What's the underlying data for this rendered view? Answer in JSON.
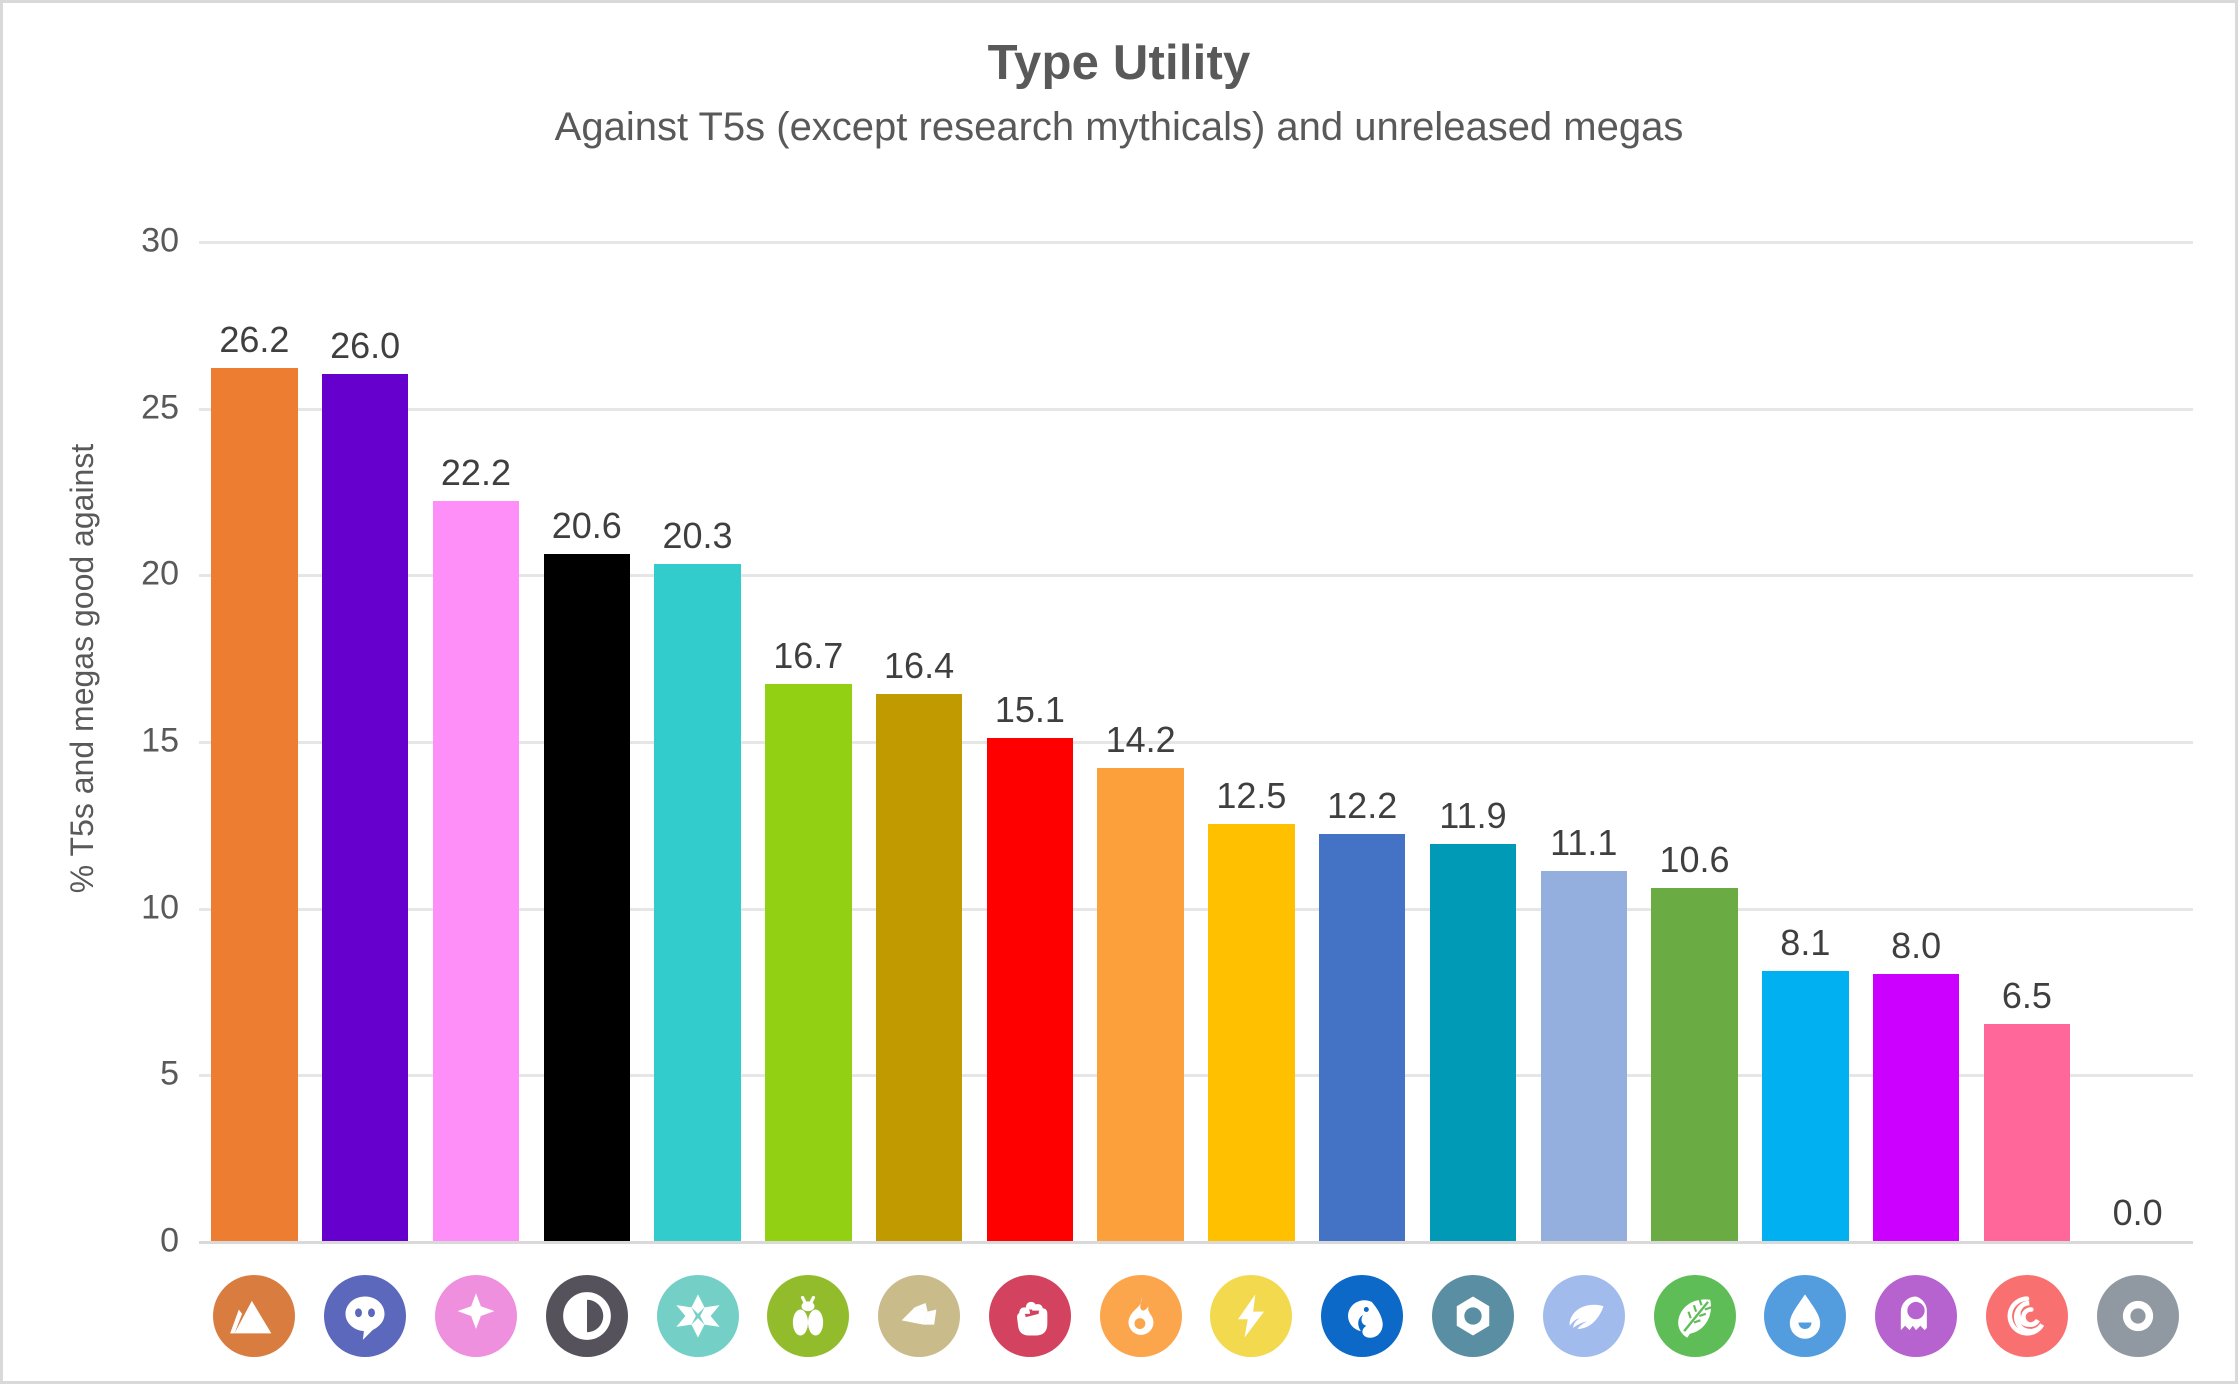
{
  "chart_data": {
    "type": "bar",
    "title": "Type Utility",
    "subtitle": "Against T5s (except research mythicals) and unreleased megas",
    "xlabel": "",
    "ylabel": "% T5s and megas good against",
    "ylim": [
      0,
      30
    ],
    "yticks": [
      "30",
      "25",
      "20",
      "15",
      "10",
      "5",
      "0"
    ],
    "ytick_values": [
      30,
      25,
      20,
      15,
      10,
      5,
      0
    ],
    "grid": true,
    "legend": "none",
    "categories": [
      "Ground",
      "Psychic",
      "Fairy",
      "Dark",
      "Ice",
      "Bug",
      "Rock",
      "Fighting",
      "Fire",
      "Electric",
      "Dragon",
      "Steel",
      "Flying",
      "Grass",
      "Water",
      "Ghost",
      "Poison",
      "Normal"
    ],
    "values": [
      26.2,
      26.0,
      22.2,
      20.6,
      20.3,
      16.7,
      16.4,
      15.1,
      14.2,
      12.5,
      12.2,
      11.9,
      11.1,
      10.6,
      8.1,
      8.0,
      6.5,
      0.0
    ],
    "data_labels": [
      "26.2",
      "26.0",
      "22.2",
      "20.6",
      "20.3",
      "16.7",
      "16.4",
      "15.1",
      "14.2",
      "12.5",
      "12.2",
      "11.9",
      "11.1",
      "10.6",
      "8.1",
      "8.0",
      "6.5",
      "0.0"
    ],
    "bar_colors": [
      "#ED7D31",
      "#6600CC",
      "#FF8FF8",
      "#000000",
      "#33CCCC",
      "#92D014",
      "#C19A00",
      "#FF0000",
      "#FCA03C",
      "#FFC000",
      "#4472C4",
      "#0099B6",
      "#94AFDD",
      "#6AAB44",
      "#00B0F0",
      "#CC00FF",
      "#FF6699",
      "#A6A6A6"
    ],
    "icons": [
      {
        "name": "ground-type-icon",
        "label": "Ground",
        "bg": "#D97C3F",
        "glyph": "mountain"
      },
      {
        "name": "psychic-type-icon",
        "label": "Psychic",
        "bg": "#5B68BB",
        "glyph": "psychic-face"
      },
      {
        "name": "fairy-type-icon",
        "label": "Fairy",
        "bg": "#EE90DE",
        "glyph": "sparkle"
      },
      {
        "name": "dark-type-icon",
        "label": "Dark",
        "bg": "#55525C",
        "glyph": "moon"
      },
      {
        "name": "ice-type-icon",
        "label": "Ice",
        "bg": "#74CFC6",
        "glyph": "snowflake"
      },
      {
        "name": "bug-type-icon",
        "label": "Bug",
        "bg": "#92BC2C",
        "glyph": "bug"
      },
      {
        "name": "rock-type-icon",
        "label": "Rock",
        "bg": "#C9BB8A",
        "glyph": "rock"
      },
      {
        "name": "fighting-type-icon",
        "label": "Fighting",
        "bg": "#D3425F",
        "glyph": "fist"
      },
      {
        "name": "fire-type-icon",
        "label": "Fire",
        "bg": "#FBA54C",
        "glyph": "flame"
      },
      {
        "name": "electric-type-icon",
        "label": "Electric",
        "bg": "#F2D94E",
        "glyph": "bolt"
      },
      {
        "name": "dragon-type-icon",
        "label": "Dragon",
        "bg": "#0C69C8",
        "glyph": "dragon"
      },
      {
        "name": "steel-type-icon",
        "label": "Steel",
        "bg": "#5A8EA2",
        "glyph": "hexagon"
      },
      {
        "name": "flying-type-icon",
        "label": "Flying",
        "bg": "#A1BBEC",
        "glyph": "wing"
      },
      {
        "name": "grass-type-icon",
        "label": "Grass",
        "bg": "#5FBD58",
        "glyph": "leaf"
      },
      {
        "name": "water-type-icon",
        "label": "Water",
        "bg": "#539DDF",
        "glyph": "droplet"
      },
      {
        "name": "ghost-type-icon",
        "label": "Ghost",
        "bg": "#B763CF",
        "glyph": "ghost"
      },
      {
        "name": "poison-type-icon",
        "label": "Poison",
        "bg": "#F87170",
        "glyph": "spiral"
      },
      {
        "name": "normal-type-icon",
        "label": "Normal",
        "bg": "#9099A1",
        "glyph": "ring"
      }
    ]
  },
  "colors": {
    "title_text": "#595959",
    "label_text": "#3f3f3f",
    "gridline": "#e6e6e6",
    "border": "#d9d9d9",
    "background": "#ffffff"
  }
}
